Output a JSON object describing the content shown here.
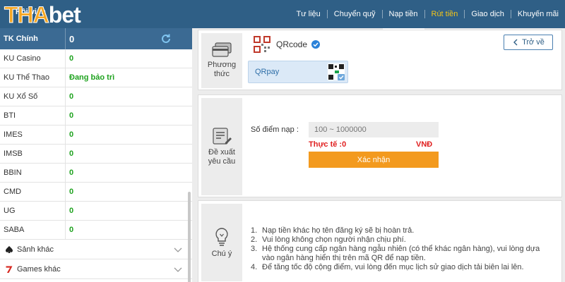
{
  "header": {
    "logo_part1": "THA",
    "logo_part2": "bet",
    "member_label": "Hội viên",
    "nav": [
      {
        "label": "Tư liệu",
        "state": "normal"
      },
      {
        "label": "Chuyển quỹ",
        "state": "normal"
      },
      {
        "label": "Nạp tiền",
        "state": "active"
      },
      {
        "label": "Rút tiền",
        "state": "highlight"
      },
      {
        "label": "Giao dịch",
        "state": "normal"
      },
      {
        "label": "Khuyến mãi",
        "state": "normal"
      }
    ]
  },
  "sidebar": {
    "main_account": {
      "name": "TK Chính",
      "value": "0"
    },
    "accounts": [
      {
        "name": "KU Casino",
        "value": "0"
      },
      {
        "name": "KU Thể Thao",
        "value": "Đang bảo trì"
      },
      {
        "name": "KU Xổ Số",
        "value": "0"
      },
      {
        "name": "BTI",
        "value": "0"
      },
      {
        "name": "IMES",
        "value": "0"
      },
      {
        "name": "IMSB",
        "value": "0"
      },
      {
        "name": "BBIN",
        "value": "0"
      },
      {
        "name": "CMD",
        "value": "0"
      },
      {
        "name": "UG",
        "value": "0"
      },
      {
        "name": "SABA",
        "value": "0"
      }
    ],
    "groups": [
      {
        "label": "Sảnh khác",
        "icon": "spade-icon"
      },
      {
        "label": "Games khác",
        "icon": "seven-icon"
      }
    ]
  },
  "method_panel": {
    "side_label_1": "Phương",
    "side_label_2": "thức",
    "qr_title": "QRcode",
    "back_label": "Trở về",
    "card_label": "QRpay"
  },
  "form_panel": {
    "side_label_1": "Đề xuất",
    "side_label_2": "yêu cầu",
    "amount_label": "Số điểm nạp :",
    "amount_placeholder": "100 ~ 1000000",
    "actual_label": "Thực tế :0",
    "currency": "VNĐ",
    "confirm_label": "Xác nhận"
  },
  "notes_panel": {
    "side_label": "Chú ý",
    "items": [
      {
        "num": "1.",
        "text": "Nạp tiền khác họ tên đăng ký sẽ bị hoàn trả."
      },
      {
        "num": "2.",
        "text": "Vui lòng không chọn người nhận chịu phí."
      },
      {
        "num": "3.",
        "text": "Hệ thống cung cấp ngân hàng ngẫu nhiên (có thể khác ngân hàng), vui lòng dựa vào ngân hàng hiển thị trên mã QR để nạp tiền."
      },
      {
        "num": "4.",
        "text": "Để tăng tốc độ cộng điểm, vui lòng đến mục lịch sử giao dịch tải biên lai lên."
      }
    ]
  },
  "colors": {
    "header_bg": "#2f5f86",
    "active_row": "#3b6a93",
    "balance_green": "#1ea21e",
    "confirm_orange": "#f39a1e",
    "alert_red": "#e02020",
    "logo_orange": "#f5a623"
  }
}
